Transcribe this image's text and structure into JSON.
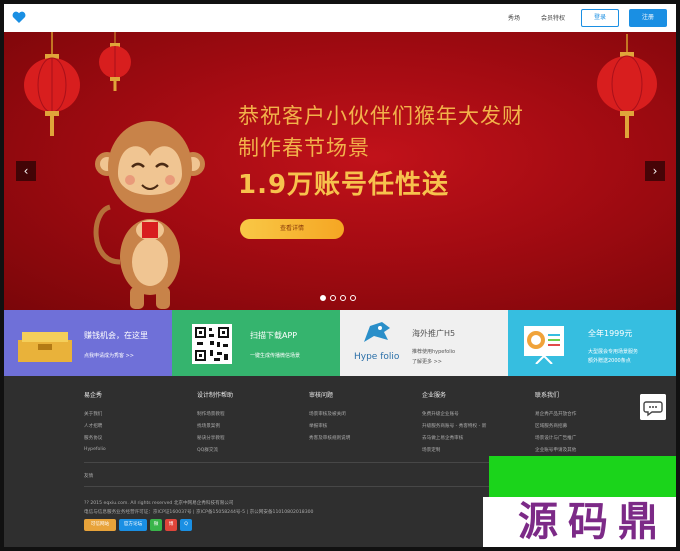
{
  "header": {
    "nav": [
      "秀场",
      "会员特权"
    ],
    "login_label": "登录",
    "register_label": "注册"
  },
  "banner": {
    "headline_1": "恭祝客户小伙伴们猴年大发财",
    "headline_2": "制作春节场景",
    "headline_3": "1.9万账号任性送",
    "cta_label": "查看详情",
    "slide_count": 4,
    "active_slide": 1,
    "prev_arrow": "‹",
    "next_arrow": "›"
  },
  "promos": [
    {
      "title": "赚钱机会，在这里",
      "sub": "点我申请成为秀客 >>",
      "color": "#6f70d8",
      "icon": "cash-box-icon"
    },
    {
      "title": "扫描下载APP",
      "sub": "一键生成传播微信场景",
      "color": "#35b46e",
      "icon": "qr-code-icon"
    },
    {
      "title": "海外推广H5",
      "sub": "推荐使用hypefolio",
      "sub2": "了解更多 >>",
      "logo": "Hype folio",
      "color": "#f0f0f0",
      "icon": "hypefolio-bird-icon"
    },
    {
      "title": "全年1999元",
      "sub": "大型展会专用场景服务",
      "sub2": "额外赠送2000条点",
      "color": "#36bee0",
      "icon": "chart-board-icon"
    }
  ],
  "footer": {
    "columns": [
      {
        "head": "易企秀",
        "links": [
          "关于我们",
          "人才招聘",
          "服务协议",
          "Hypefolio"
        ]
      },
      {
        "head": "设计制作帮助",
        "links": [
          "制作场景教程",
          "找场景案例",
          "秘诀分享教程",
          "QQ群交流"
        ]
      },
      {
        "head": "审核问题",
        "links": [
          "场景审核及被关闭",
          "举报审核",
          "秀客及审核规则说明"
        ]
      },
      {
        "head": "企业服务",
        "links": [
          "免费升级企业账号",
          "升级服务商账号 - 秀客特权 - 新",
          "去马做上易企秀审核",
          "场景定制"
        ]
      },
      {
        "head": "联系我们",
        "links": [
          "易企秀产品开放合作",
          "区域服务商招募",
          "场景设计与广告推广",
          "企业账号申请及其他"
        ]
      }
    ],
    "friend_links": "友情",
    "copyright": "?? 2015 eqxiu.com. All rights reserved 北京中网易企秀科技有限公司",
    "licenses": "电信与信息服务业务经营许可证：京ICP证160037号 | 京ICP备15058244号-5 | 京公网安备11010802018300",
    "badges": [
      {
        "label": "可信网站",
        "color": "#e8a33a"
      },
      {
        "label": "官方论坛",
        "color": "#1a8fe3"
      },
      {
        "label": "微",
        "color": "#39b54a"
      },
      {
        "label": "博",
        "color": "#e0453a"
      },
      {
        "label": "Q",
        "color": "#1a8fe3"
      }
    ]
  },
  "watermark": {
    "text": "源码鼎",
    "color": "#7c2a87",
    "green": "#1bd41b"
  }
}
